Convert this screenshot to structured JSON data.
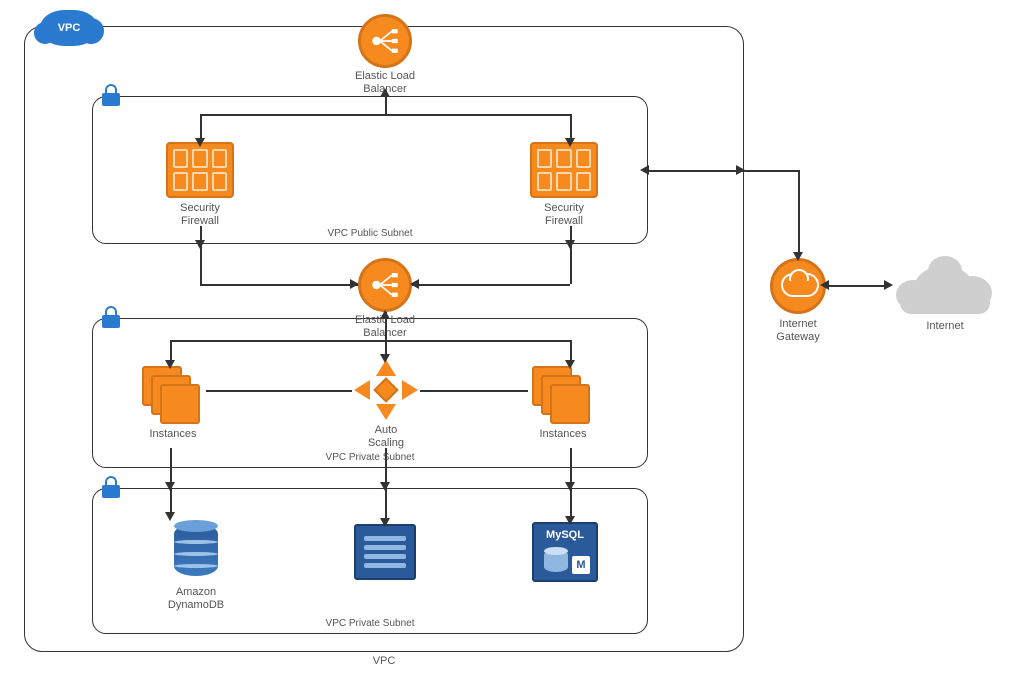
{
  "vpc": {
    "badge": "VPC",
    "label": "VPC"
  },
  "public_subnet": {
    "label": "VPC Public Subnet",
    "elb_label_line1": "Elastic Load",
    "elb_label_line2": "Balancer",
    "firewall_left_line1": "Security",
    "firewall_left_line2": "Firewall",
    "firewall_right_line1": "Security",
    "firewall_right_line2": "Firewall"
  },
  "private_subnet_app": {
    "label": "VPC Private Subnet",
    "elb_label_line1": "Elastic Load",
    "elb_label_line2": "Balancer",
    "instances_left": "Instances",
    "scaling_line1": "Auto",
    "scaling_line2": "Scaling",
    "instances_right": "Instances"
  },
  "private_subnet_db": {
    "label": "VPC Private Subnet",
    "dynamodb_line1": "Amazon",
    "dynamodb_line2": "DynamoDB",
    "mysql": "MySQL",
    "mysql_badge": "M"
  },
  "gateway": {
    "label_line1": "Internet",
    "label_line2": "Gateway"
  },
  "internet": {
    "label": "Internet"
  }
}
